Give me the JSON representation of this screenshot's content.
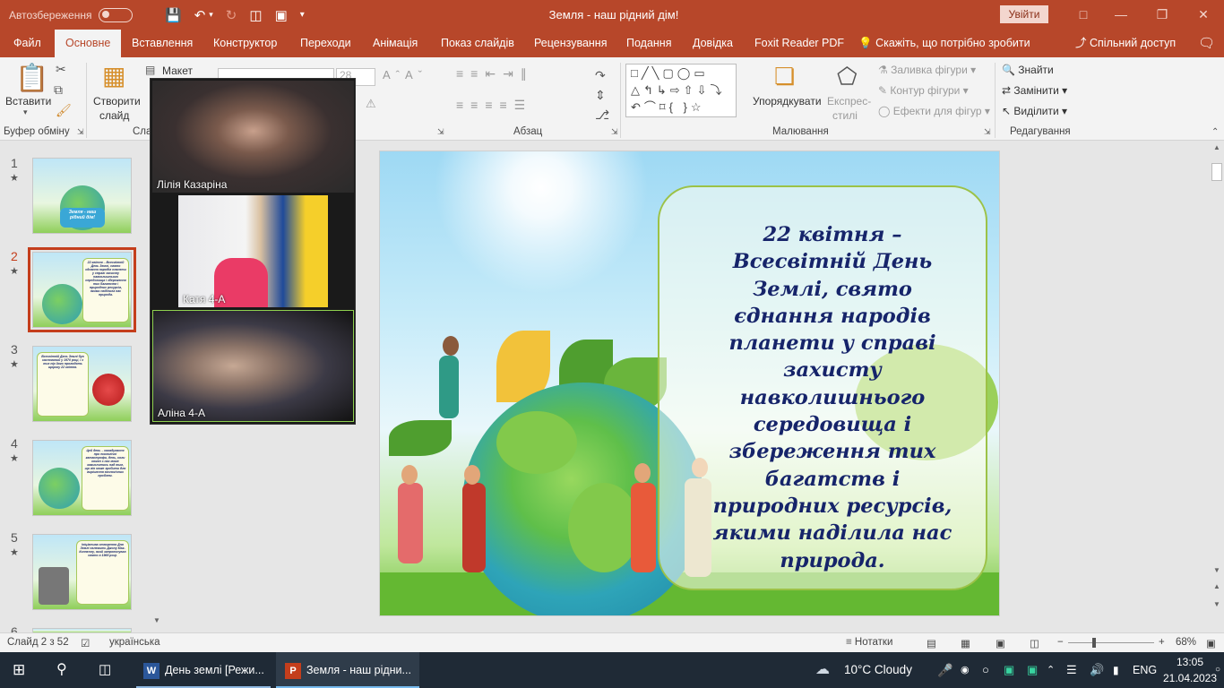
{
  "titlebar": {
    "autosave_label": "Автозбереження",
    "title": "Земля - наш рідний дім!",
    "signin": "Увійти",
    "colors": {
      "accent": "#b7472a"
    }
  },
  "tabs": [
    {
      "label": "Файл"
    },
    {
      "label": "Основне"
    },
    {
      "label": "Вставлення"
    },
    {
      "label": "Конструктор"
    },
    {
      "label": "Переходи"
    },
    {
      "label": "Анімація"
    },
    {
      "label": "Показ слайдів"
    },
    {
      "label": "Рецензування"
    },
    {
      "label": "Подання"
    },
    {
      "label": "Довідка"
    },
    {
      "label": "Foxit Reader PDF"
    },
    {
      "label": "Скажіть, що потрібно зробити"
    }
  ],
  "share_label": "Спільний доступ",
  "ribbon": {
    "paste": "Вставити",
    "clipboard_group": "Буфер обміну",
    "new_slide_1": "Створити",
    "new_slide_2": "слайд",
    "layout": "Макет",
    "slides_group": "Сла",
    "font_size": "28",
    "paragraph_group": "Абзац",
    "arrange": "Упорядкувати",
    "quick_styles_1": "Експрес-",
    "quick_styles_2": "стилі",
    "shape_fill": "Заливка фігури",
    "shape_outline": "Контур фігури",
    "shape_effects": "Ефекти для фігур",
    "drawing_group": "Малювання",
    "find": "Знайти",
    "replace": "Замінити",
    "select": "Виділити",
    "editing_group": "Редагування"
  },
  "slides": [
    {
      "num": "1",
      "card": "Земля - наш рідний дім!"
    },
    {
      "num": "2",
      "card": "22 квітня – Всесвітній День Землі, свято єднання народів планети у справі захисту навколишнього середовища і збереження тих багатств і природних ресурсів, якими наділила нас природа."
    },
    {
      "num": "3",
      "card": "Всесвітній День Землі був заснований у 1970 році, і з тих пір його проводять щороку 22 квітня."
    },
    {
      "num": "4",
      "card": "Цей день – нагадування про екологічні катастрофи, день, коли кожен з нас може замислитись над тим, що він може зробити для вирішення екологічних проблем."
    },
    {
      "num": "5",
      "card": "Ініціатива створення Дня Землі належить Джону Мак-Коннеллу, який запропонував свято в 1969 році."
    },
    {
      "num": "6",
      "card": ""
    }
  ],
  "slide_text": "22 квітня – Всесвітній День Землі, свято єднання народів планети у справі захисту навколишнього середовища і збереження тих багатств і природних ресурсів, якими наділила нас природа.",
  "video": {
    "participants": [
      {
        "name": "Лілія Казаріна"
      },
      {
        "name": "Катя  4-А"
      },
      {
        "name": "Аліна 4-А"
      }
    ]
  },
  "status": {
    "slide_counter": "Слайд 2 з 52",
    "language": "українська",
    "notes": "Нотатки",
    "zoom": "68%"
  },
  "taskbar": {
    "app1": "День землі [Режи...",
    "app2": "Земля - наш рідни...",
    "weather": "10°C  Cloudy",
    "lang": "ENG",
    "time": "13:05",
    "date": "21.04.2023"
  }
}
